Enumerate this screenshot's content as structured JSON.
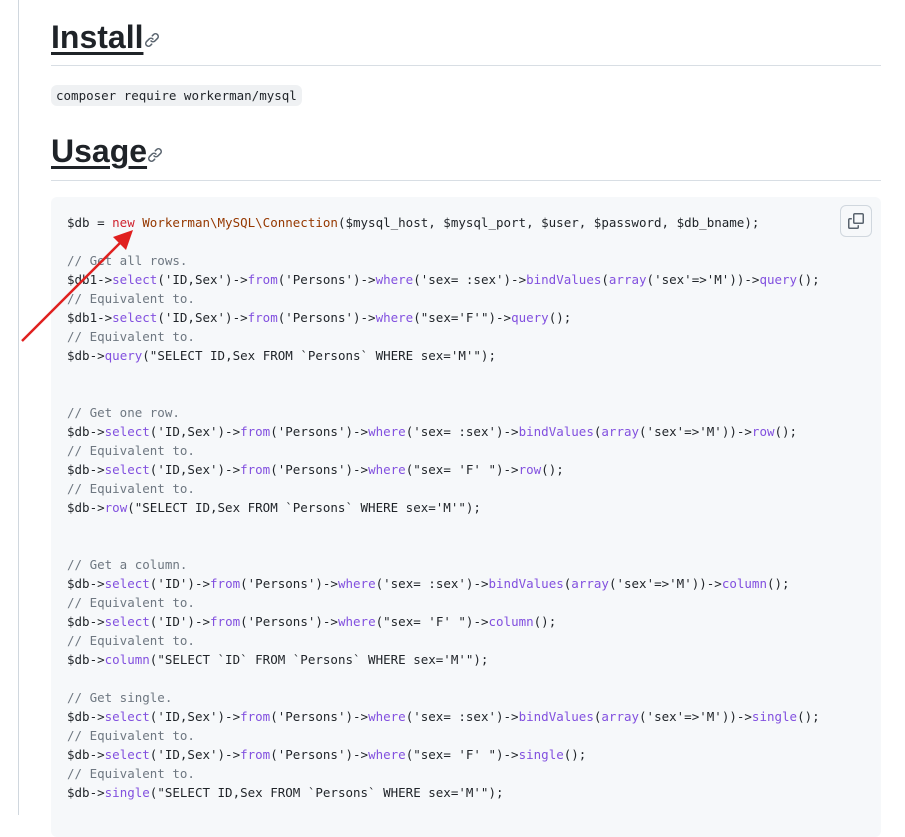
{
  "headings": {
    "install": "Install",
    "usage": "Usage"
  },
  "install_command": "composer require workerman/mysql",
  "icons": {
    "anchor": "link-icon",
    "copy": "copy-icon"
  },
  "colors": {
    "keyword": "#cf222e",
    "class": "#953800",
    "method": "#8250df",
    "string": "#0a3069",
    "comment": "#6e7781",
    "annotation_arrow": "#e0201f"
  },
  "code_lines": [
    [
      [
        "plain",
        "$db = "
      ],
      [
        "keyword",
        "new"
      ],
      [
        "plain",
        " "
      ],
      [
        "class",
        "Workerman\\MySQL\\Connection"
      ],
      [
        "plain",
        "($mysql_host, $mysql_port, $user, $password, $db_bname);"
      ]
    ],
    [],
    [
      [
        "comment",
        "// Get all rows."
      ]
    ],
    [
      [
        "plain",
        "$db1->"
      ],
      [
        "method",
        "select"
      ],
      [
        "plain",
        "('ID,Sex')->"
      ],
      [
        "method",
        "from"
      ],
      [
        "plain",
        "('Persons')->"
      ],
      [
        "method",
        "where"
      ],
      [
        "plain",
        "('sex= :sex')->"
      ],
      [
        "method",
        "bindValues"
      ],
      [
        "plain",
        "("
      ],
      [
        "method",
        "array"
      ],
      [
        "plain",
        "('sex'=>'M'))->"
      ],
      [
        "method",
        "query"
      ],
      [
        "plain",
        "();"
      ]
    ],
    [
      [
        "comment",
        "// Equivalent to."
      ]
    ],
    [
      [
        "plain",
        "$db1->"
      ],
      [
        "method",
        "select"
      ],
      [
        "plain",
        "('ID,Sex')->"
      ],
      [
        "method",
        "from"
      ],
      [
        "plain",
        "('Persons')->"
      ],
      [
        "method",
        "where"
      ],
      [
        "plain",
        "(\"sex='F'\")->"
      ],
      [
        "method",
        "query"
      ],
      [
        "plain",
        "();"
      ]
    ],
    [
      [
        "comment",
        "// Equivalent to."
      ]
    ],
    [
      [
        "plain",
        "$db->"
      ],
      [
        "method",
        "query"
      ],
      [
        "plain",
        "(\"SELECT ID,Sex FROM `Persons` WHERE sex='M'\");"
      ]
    ],
    [],
    [],
    [
      [
        "comment",
        "// Get one row."
      ]
    ],
    [
      [
        "plain",
        "$db->"
      ],
      [
        "method",
        "select"
      ],
      [
        "plain",
        "('ID,Sex')->"
      ],
      [
        "method",
        "from"
      ],
      [
        "plain",
        "('Persons')->"
      ],
      [
        "method",
        "where"
      ],
      [
        "plain",
        "('sex= :sex')->"
      ],
      [
        "method",
        "bindValues"
      ],
      [
        "plain",
        "("
      ],
      [
        "method",
        "array"
      ],
      [
        "plain",
        "('sex'=>'M'))->"
      ],
      [
        "method",
        "row"
      ],
      [
        "plain",
        "();"
      ]
    ],
    [
      [
        "comment",
        "// Equivalent to."
      ]
    ],
    [
      [
        "plain",
        "$db->"
      ],
      [
        "method",
        "select"
      ],
      [
        "plain",
        "('ID,Sex')->"
      ],
      [
        "method",
        "from"
      ],
      [
        "plain",
        "('Persons')->"
      ],
      [
        "method",
        "where"
      ],
      [
        "plain",
        "(\"sex= 'F' \")->"
      ],
      [
        "method",
        "row"
      ],
      [
        "plain",
        "();"
      ]
    ],
    [
      [
        "comment",
        "// Equivalent to."
      ]
    ],
    [
      [
        "plain",
        "$db->"
      ],
      [
        "method",
        "row"
      ],
      [
        "plain",
        "(\"SELECT ID,Sex FROM `Persons` WHERE sex='M'\");"
      ]
    ],
    [],
    [],
    [
      [
        "comment",
        "// Get a column."
      ]
    ],
    [
      [
        "plain",
        "$db->"
      ],
      [
        "method",
        "select"
      ],
      [
        "plain",
        "('ID')->"
      ],
      [
        "method",
        "from"
      ],
      [
        "plain",
        "('Persons')->"
      ],
      [
        "method",
        "where"
      ],
      [
        "plain",
        "('sex= :sex')->"
      ],
      [
        "method",
        "bindValues"
      ],
      [
        "plain",
        "("
      ],
      [
        "method",
        "array"
      ],
      [
        "plain",
        "('sex'=>'M'))->"
      ],
      [
        "method",
        "column"
      ],
      [
        "plain",
        "();"
      ]
    ],
    [
      [
        "comment",
        "// Equivalent to."
      ]
    ],
    [
      [
        "plain",
        "$db->"
      ],
      [
        "method",
        "select"
      ],
      [
        "plain",
        "('ID')->"
      ],
      [
        "method",
        "from"
      ],
      [
        "plain",
        "('Persons')->"
      ],
      [
        "method",
        "where"
      ],
      [
        "plain",
        "(\"sex= 'F' \")->"
      ],
      [
        "method",
        "column"
      ],
      [
        "plain",
        "();"
      ]
    ],
    [
      [
        "comment",
        "// Equivalent to."
      ]
    ],
    [
      [
        "plain",
        "$db->"
      ],
      [
        "method",
        "column"
      ],
      [
        "plain",
        "(\"SELECT `ID` FROM `Persons` WHERE sex='M'\");"
      ]
    ],
    [],
    [
      [
        "comment",
        "// Get single."
      ]
    ],
    [
      [
        "plain",
        "$db->"
      ],
      [
        "method",
        "select"
      ],
      [
        "plain",
        "('ID,Sex')->"
      ],
      [
        "method",
        "from"
      ],
      [
        "plain",
        "('Persons')->"
      ],
      [
        "method",
        "where"
      ],
      [
        "plain",
        "('sex= :sex')->"
      ],
      [
        "method",
        "bindValues"
      ],
      [
        "plain",
        "("
      ],
      [
        "method",
        "array"
      ],
      [
        "plain",
        "('sex'=>'M'))->"
      ],
      [
        "method",
        "single"
      ],
      [
        "plain",
        "();"
      ]
    ],
    [
      [
        "comment",
        "// Equivalent to."
      ]
    ],
    [
      [
        "plain",
        "$db->"
      ],
      [
        "method",
        "select"
      ],
      [
        "plain",
        "('ID,Sex')->"
      ],
      [
        "method",
        "from"
      ],
      [
        "plain",
        "('Persons')->"
      ],
      [
        "method",
        "where"
      ],
      [
        "plain",
        "(\"sex= 'F' \")->"
      ],
      [
        "method",
        "single"
      ],
      [
        "plain",
        "();"
      ]
    ],
    [
      [
        "comment",
        "// Equivalent to."
      ]
    ],
    [
      [
        "plain",
        "$db->"
      ],
      [
        "method",
        "single"
      ],
      [
        "plain",
        "(\"SELECT ID,Sex FROM `Persons` WHERE sex='M'\");"
      ]
    ]
  ]
}
